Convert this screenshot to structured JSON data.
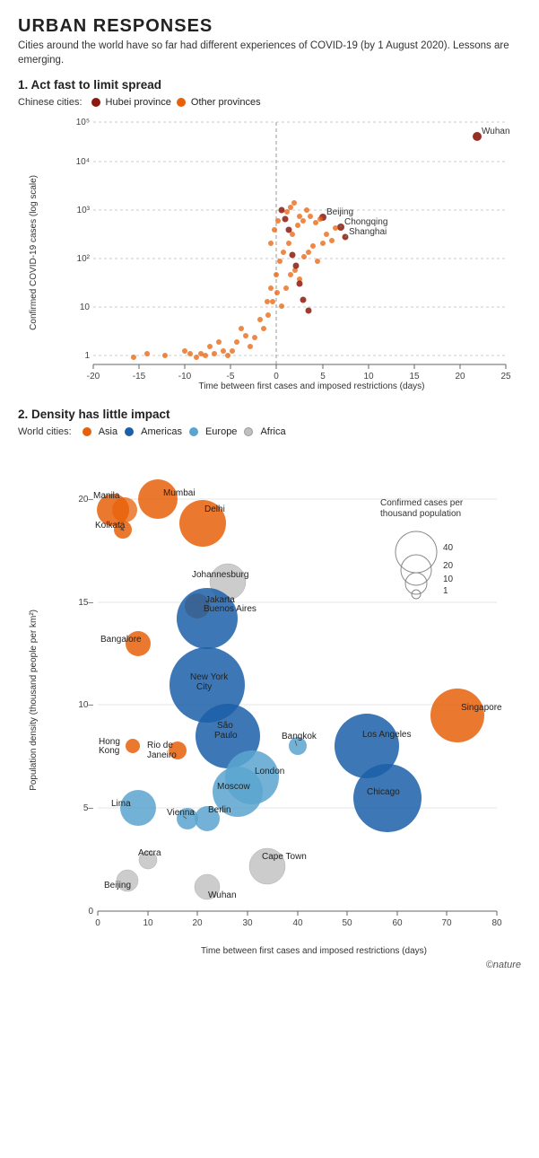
{
  "header": {
    "title": "URBAN RESPONSES",
    "subtitle": "Cities around the world have so far had different experiences of COVID-19 (by 1 August 2020). Lessons are emerging."
  },
  "section1": {
    "title": "1. Act fast to limit spread",
    "legend_prefix": "Chinese cities:",
    "legend_items": [
      {
        "label": "Hubei province",
        "color": "#8B1A0E"
      },
      {
        "label": "Other provinces",
        "color": "#E8600A"
      }
    ]
  },
  "section2": {
    "title": "2. Density has little impact",
    "legend_prefix": "World cities:",
    "legend_items": [
      {
        "label": "Asia",
        "color": "#E8600A"
      },
      {
        "label": "Americas",
        "color": "#1B5FA8"
      },
      {
        "label": "Europe",
        "color": "#5BA4CF"
      },
      {
        "label": "Africa",
        "color": "#C0C0C0"
      }
    ]
  },
  "chart1": {
    "y_axis_label": "Confirmed COVID-19 cases (log scale)",
    "x_axis_label": "Time between first cases and imposed restrictions (days)",
    "y_ticks": [
      "1",
      "10",
      "100",
      "1,000",
      "10,000",
      "100,000"
    ],
    "x_ticks": [
      "-20",
      "-15",
      "-10",
      "-5",
      "0",
      "5",
      "10",
      "15",
      "20",
      "25"
    ],
    "labeled_points": [
      {
        "label": "Wuhan",
        "x": 22,
        "y": 50000,
        "color": "#8B1A0E"
      },
      {
        "label": "Beijing",
        "x": 5,
        "y": 900,
        "color": "#8B1A0E"
      },
      {
        "label": "Chongqing",
        "x": 7,
        "y": 570,
        "color": "#8B1A0E"
      },
      {
        "label": "Shanghai",
        "x": 7.5,
        "y": 340,
        "color": "#8B1A0E"
      }
    ]
  },
  "chart2": {
    "y_axis_label": "Population density (thousand people per km²)",
    "x_axis_label": "Time between first cases and imposed restrictions (days)",
    "y_ticks": [
      "0",
      "5",
      "10",
      "15",
      "20"
    ],
    "x_ticks": [
      "0",
      "10",
      "20",
      "30",
      "40",
      "50",
      "60",
      "70",
      "80"
    ],
    "size_legend_title": "Confirmed cases per\nthousand population",
    "size_legend_items": [
      {
        "label": "40",
        "size": 46
      },
      {
        "label": "20",
        "size": 34
      },
      {
        "label": "10",
        "size": 24
      },
      {
        "label": "1",
        "size": 10
      }
    ],
    "labeled_points": [
      {
        "label": "Manila",
        "x": 3,
        "y": 19.5,
        "color": "#E8600A",
        "r": 18
      },
      {
        "label": "Mumbai",
        "x": 12,
        "y": 20,
        "color": "#E8600A",
        "r": 22
      },
      {
        "label": "Kolkata",
        "x": 5,
        "y": 18.5,
        "color": "#E8600A",
        "r": 12
      },
      {
        "label": "Delhi",
        "x": 21,
        "y": 18.8,
        "color": "#E8600A",
        "r": 26
      },
      {
        "label": "Johannesburg",
        "x": 26,
        "y": 16,
        "color": "#C0C0C0",
        "r": 20
      },
      {
        "label": "Jakarta",
        "x": 20,
        "y": 14.8,
        "color": "#E8600A",
        "r": 14
      },
      {
        "label": "Buenos Aires",
        "x": 22,
        "y": 14.2,
        "color": "#1B5FA8",
        "r": 34
      },
      {
        "label": "Bangalore",
        "x": 8,
        "y": 13,
        "color": "#E8600A",
        "r": 14
      },
      {
        "label": "New York City",
        "x": 22,
        "y": 11,
        "color": "#1B5FA8",
        "r": 42
      },
      {
        "label": "Singapore",
        "x": 72,
        "y": 9.5,
        "color": "#E8600A",
        "r": 30
      },
      {
        "label": "Hong Kong",
        "x": 7,
        "y": 8,
        "color": "#E8600A",
        "r": 8
      },
      {
        "label": "São Paulo",
        "x": 26,
        "y": 8.5,
        "color": "#1B5FA8",
        "r": 36
      },
      {
        "label": "Rio de Janeiro",
        "x": 16,
        "y": 7.8,
        "color": "#E8600A",
        "r": 10
      },
      {
        "label": "Bangkok",
        "x": 40,
        "y": 8,
        "color": "#5BA4CF",
        "r": 10
      },
      {
        "label": "Los Angeles",
        "x": 54,
        "y": 8,
        "color": "#1B5FA8",
        "r": 36
      },
      {
        "label": "London",
        "x": 31,
        "y": 6.5,
        "color": "#5BA4CF",
        "r": 30
      },
      {
        "label": "Moscow",
        "x": 28,
        "y": 5.8,
        "color": "#5BA4CF",
        "r": 28
      },
      {
        "label": "Chicago",
        "x": 58,
        "y": 5.5,
        "color": "#1B5FA8",
        "r": 38
      },
      {
        "label": "Lima",
        "x": 8,
        "y": 5,
        "color": "#1B5FA8",
        "r": 20
      },
      {
        "label": "Vienna",
        "x": 18,
        "y": 4.5,
        "color": "#5BA4CF",
        "r": 12
      },
      {
        "label": "Berlin",
        "x": 22,
        "y": 4.5,
        "color": "#5BA4CF",
        "r": 14
      },
      {
        "label": "Accra",
        "x": 10,
        "y": 2.5,
        "color": "#C0C0C0",
        "r": 10
      },
      {
        "label": "Beijing",
        "x": 6,
        "y": 1.5,
        "color": "#8B1A0E",
        "r": 12
      },
      {
        "label": "Wuhan",
        "x": 22,
        "y": 1.2,
        "color": "#8B1A0E",
        "r": 14
      },
      {
        "label": "Cape Town",
        "x": 34,
        "y": 2.2,
        "color": "#C0C0C0",
        "r": 20
      }
    ]
  },
  "nature_logo": "©nature"
}
